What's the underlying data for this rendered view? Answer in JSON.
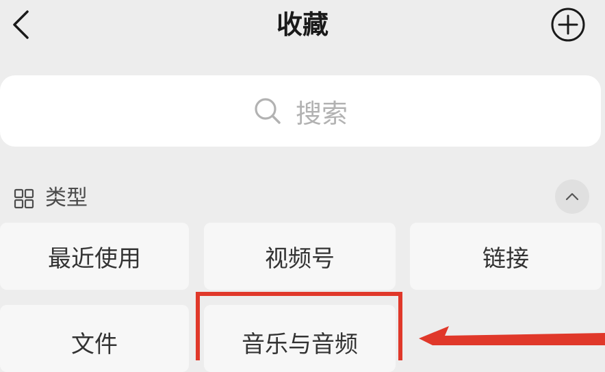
{
  "header": {
    "title": "收藏",
    "back_icon": "chevron-left-icon",
    "add_icon": "plus-circle-icon"
  },
  "search": {
    "placeholder": "搜索",
    "icon": "search-icon"
  },
  "section": {
    "title": "类型",
    "icon": "grid-icon",
    "collapse_icon": "chevron-up-icon"
  },
  "categories": [
    {
      "label": "最近使用"
    },
    {
      "label": "视频号"
    },
    {
      "label": "链接"
    },
    {
      "label": "文件"
    },
    {
      "label": "音乐与音频"
    }
  ],
  "colors": {
    "background": "#ededed",
    "card": "#f7f7f7",
    "highlight": "#e0382a"
  }
}
